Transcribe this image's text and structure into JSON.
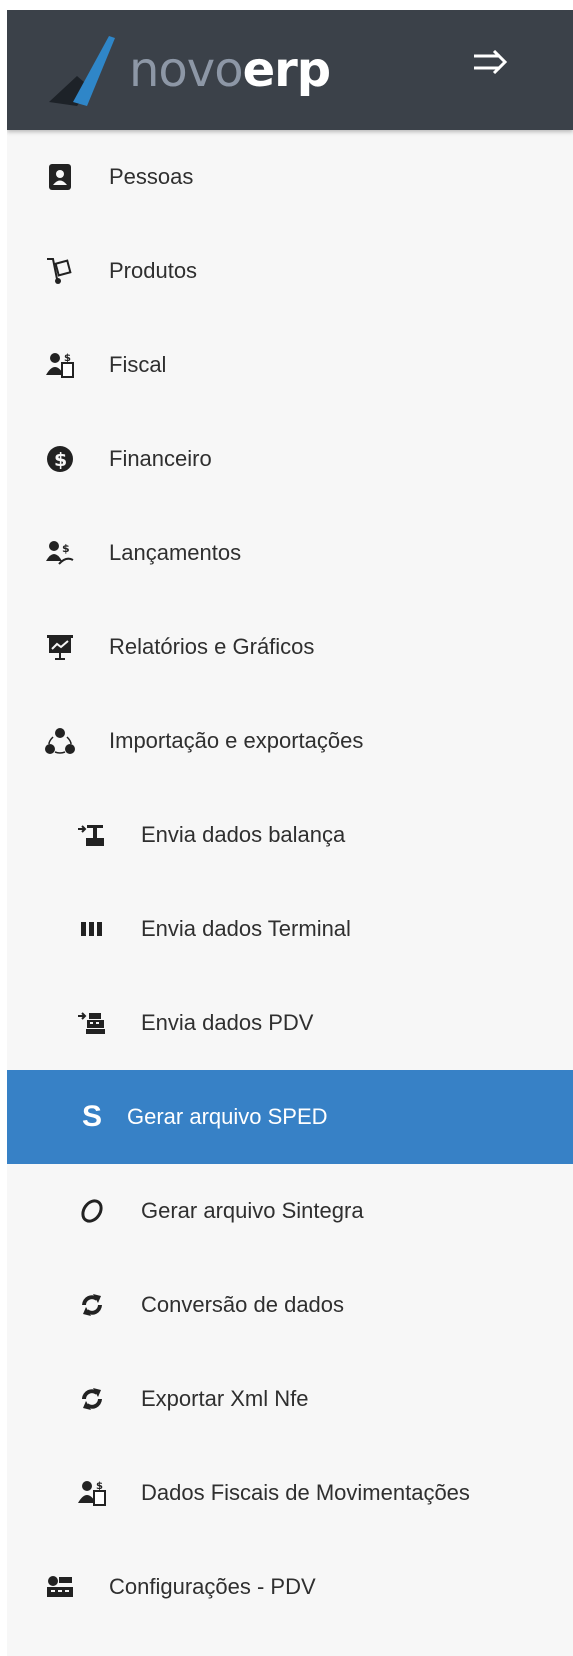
{
  "brand": {
    "name_light": "novo",
    "name_bold": "erp"
  },
  "header": {
    "toggle_icon": "menu-collapse-icon"
  },
  "colors": {
    "topbar": "#3b4149",
    "active": "#3781c6",
    "logo_blue": "#2f86c8"
  },
  "menu": {
    "items": [
      {
        "label": "Pessoas",
        "icon": "contacts-icon"
      },
      {
        "label": "Produtos",
        "icon": "hand-truck-icon"
      },
      {
        "label": "Fiscal",
        "icon": "fiscal-user-icon"
      },
      {
        "label": "Financeiro",
        "icon": "dollar-circle-icon"
      },
      {
        "label": "Lançamentos",
        "icon": "money-transfer-icon"
      },
      {
        "label": "Relatórios e Gráficos",
        "icon": "presentation-chart-icon"
      },
      {
        "label": "Importação e exportações",
        "icon": "share-network-icon"
      }
    ],
    "subitems": [
      {
        "label": "Envia dados balança",
        "icon": "scale-upload-icon"
      },
      {
        "label": "Envia dados Terminal",
        "icon": "barcode-icon"
      },
      {
        "label": "Envia dados PDV",
        "icon": "pos-upload-icon"
      },
      {
        "label": "Gerar arquivo SPED",
        "icon": "sped-s-icon",
        "active": true,
        "glyph": "S"
      },
      {
        "label": "Gerar arquivo Sintegra",
        "icon": "sintegra-icon"
      },
      {
        "label": "Conversão de dados",
        "icon": "refresh-icon"
      },
      {
        "label": "Exportar Xml Nfe",
        "icon": "refresh-icon"
      },
      {
        "label": "Dados Fiscais de Movimentações",
        "icon": "fiscal-user-icon"
      }
    ],
    "footer_item": {
      "label": "Configurações - PDV",
      "icon": "pos-config-icon"
    }
  }
}
